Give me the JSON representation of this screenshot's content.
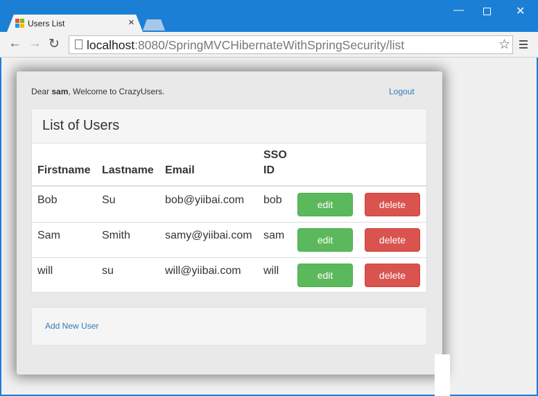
{
  "browser": {
    "tab_title": "Users List",
    "tab_close": "×",
    "url_host": "localhost",
    "url_rest": ":8080/SpringMVCHibernateWithSpringSecurity/list",
    "controls": {
      "minimize": "—",
      "close": "✕"
    },
    "nav": {
      "back": "←",
      "forward": "→",
      "reload": "↻",
      "star": "☆"
    }
  },
  "header": {
    "welcome_prefix": "Dear ",
    "username": "sam",
    "welcome_suffix": ", Welcome to CrazyUsers.",
    "logout_label": "Logout"
  },
  "panel": {
    "title": "List of Users",
    "columns": [
      "Firstname",
      "Lastname",
      "Email",
      "SSO",
      "ID"
    ],
    "rows": [
      {
        "firstname": "Bob",
        "lastname": "Su",
        "email": "bob@yiibai.com",
        "sso": "bob"
      },
      {
        "firstname": "Sam",
        "lastname": "Smith",
        "email": "samy@yiibai.com",
        "sso": "sam"
      },
      {
        "firstname": "will",
        "lastname": "su",
        "email": "will@yiibai.com",
        "sso": "will"
      }
    ],
    "edit_label": "edit",
    "delete_label": "delete"
  },
  "footer": {
    "add_link": "Add New User"
  },
  "colors": {
    "chrome_blue": "#1b7fd6",
    "edit_green": "#5cb85c",
    "delete_red": "#d9534f",
    "link_blue": "#337ab7"
  }
}
